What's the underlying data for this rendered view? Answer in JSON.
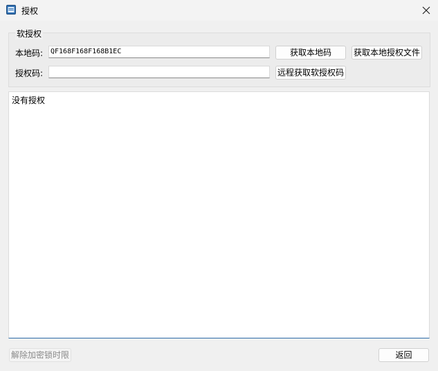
{
  "window": {
    "title": "授权",
    "icon": "window-app-icon",
    "close_icon": "close-icon"
  },
  "software_auth": {
    "group_title": "软授权",
    "local_code_label": "本地码:",
    "local_code_value": "QF168F168F168B1EC",
    "auth_code_label": "授权码:",
    "auth_code_value": "",
    "get_local_code_button": "获取本地码",
    "get_local_auth_file_button": "获取本地授权文件",
    "remote_get_auth_code_button": "远程获取软授权码"
  },
  "status": {
    "text": "没有授权"
  },
  "footer": {
    "unlock_time_limit_button": "解除加密锁时限",
    "back_button": "返回"
  }
}
